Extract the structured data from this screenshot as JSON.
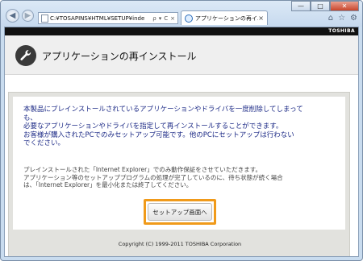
{
  "browser": {
    "address": "C:¥TOSAPINS¥HTML¥SETUP¥inde",
    "address_actions": [
      "ρ",
      "▾",
      "C",
      "×"
    ],
    "tab_title": "アプリケーションの再イ...",
    "tab_close": "×",
    "window_controls": [
      "—",
      "□",
      "✕"
    ],
    "tool_icons": [
      "home-icon",
      "favorites-icon",
      "tools-icon"
    ]
  },
  "brand": {
    "logo": "TOSHIBA"
  },
  "header": {
    "title": "アプリケーションの再インストール"
  },
  "message": {
    "lines": [
      "本製品にプレインストールされているアプリケーションやドライバを一度削除してしまって",
      "も、",
      "必要なアプリケーションやドライバを指定して再インストールすることができます。",
      "お客様が購入されたPCでのみセットアップ可能です。他のPCにセットアップは行わない",
      "でください。"
    ]
  },
  "note": {
    "lines": [
      "プレインストールされた「Internet Explorer」でのみ動作保証をさせていただきます。",
      "アプリケーション等のセットアッププログラムの処理が完了しているのに、待ち状態が続く場合",
      "は、「Internet Explorer」を最小化または終了してください。"
    ]
  },
  "setup_button": {
    "label": "セットアップ画面へ"
  },
  "footer": {
    "copyright": "Copyright (C) 1999-2011 TOSHIBA Corporation"
  },
  "colors": {
    "accent_orange": "#f09a1a",
    "message_text": "#1c2a86",
    "brand_bar": "#111111"
  }
}
